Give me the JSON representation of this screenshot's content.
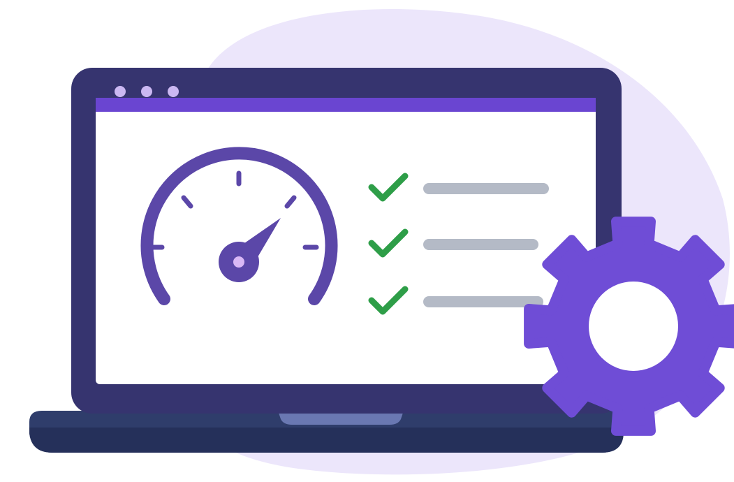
{
  "illustration": {
    "colors": {
      "background": "#ffffff",
      "blob": "#ece6fb",
      "laptop_frame": "#36346f",
      "laptop_base": "#2f3d6b",
      "laptop_base_edge": "#25305a",
      "laptop_notch": "#6a78b2",
      "title_bar": "#6a45d1",
      "window_dots": "#cbb8f2",
      "screen": "#ffffff",
      "gauge": "#5b47a8",
      "gauge_hub_dot": "#d9b8f5",
      "check": "#2e9e48",
      "line": "#b4bac6",
      "gear": "#6f4dd6",
      "gear_hole": "#ffffff"
    },
    "window_controls": [
      "dot-icon",
      "dot-icon",
      "dot-icon"
    ],
    "checklist": [
      {
        "icon": "check-icon",
        "line": "placeholder-line"
      },
      {
        "icon": "check-icon",
        "line": "placeholder-line"
      },
      {
        "icon": "check-icon",
        "line": "placeholder-line"
      }
    ],
    "gauge_icon": "speedometer-icon",
    "gear_icon": "gear-icon",
    "device_icon": "laptop-icon"
  }
}
